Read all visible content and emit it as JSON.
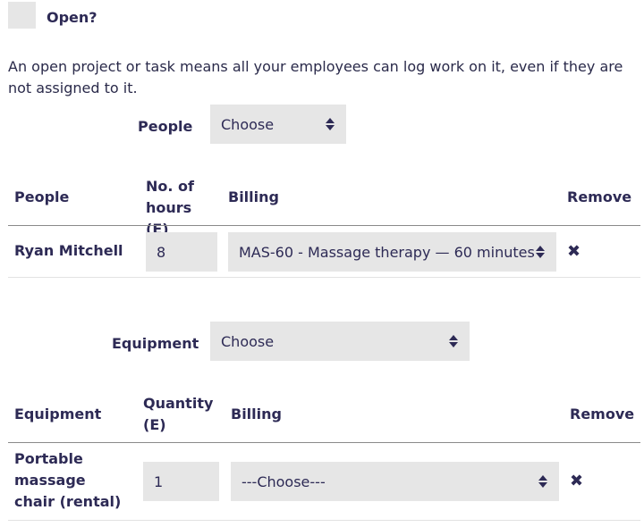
{
  "open": {
    "label": "Open?",
    "checked": false
  },
  "description": "An open project or task means all your employees can log work on it, even if they are not assigned to it.",
  "people": {
    "picker_label": "People",
    "picker_value": "Choose",
    "headers": {
      "name": "People",
      "hours": "No. of hours (E)",
      "billing": "Billing",
      "remove": "Remove"
    },
    "rows": [
      {
        "name": "Ryan Mitchell",
        "hours": "8",
        "billing": "MAS-60 - Massage therapy — 60 minutes",
        "remove_icon": "close-icon"
      }
    ]
  },
  "equipment": {
    "picker_label": "Equipment",
    "picker_value": "Choose",
    "headers": {
      "name": "Equipment",
      "quantity": "Quantity (E)",
      "billing": "Billing",
      "remove": "Remove"
    },
    "rows": [
      {
        "name": "Portable massage chair (rental)",
        "quantity": "1",
        "billing": "---Choose---",
        "remove_icon": "close-icon"
      }
    ]
  }
}
